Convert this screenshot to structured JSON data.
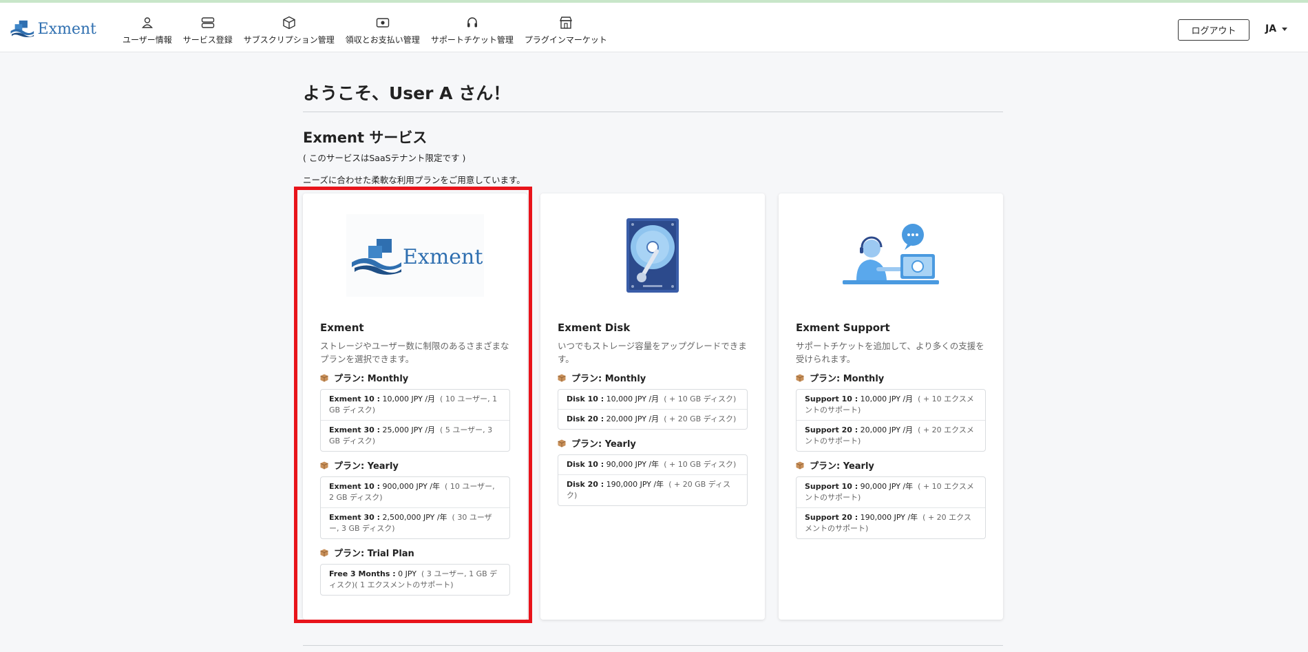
{
  "header": {
    "logo_text": "Exment",
    "nav": [
      {
        "label": "ユーザー情報",
        "icon": "user-icon"
      },
      {
        "label": "サービス登録",
        "icon": "server-icon"
      },
      {
        "label": "サブスクリプション管理",
        "icon": "box-icon"
      },
      {
        "label": "領収とお支払い管理",
        "icon": "money-icon"
      },
      {
        "label": "サポートチケット管理",
        "icon": "headset-icon"
      },
      {
        "label": "プラグインマーケット",
        "icon": "store-icon"
      }
    ],
    "logout_label": "ログアウト",
    "lang_label": "JA"
  },
  "main": {
    "welcome": "ようこそ、User A さん！",
    "services_title": "Exment サービス",
    "services_note": "( このサービスはSaaSテナント限定です )",
    "services_desc": "ニーズに合わせた柔軟な利用プランをご用意しています。"
  },
  "cards": [
    {
      "title": "Exment",
      "desc": "ストレージやユーザー数に制限のあるさまざまなプランを選択できます。",
      "logo_text": "Exment",
      "plans": [
        {
          "heading": "プラン: Monthly",
          "items": [
            {
              "name": "Exment 10 :",
              "price": "10,000 JPY /月",
              "detail": "( 10 ユーザー, 1 GB ディスク)"
            },
            {
              "name": "Exment 30 :",
              "price": "25,000 JPY /月",
              "detail": "( 5 ユーザー, 3 GB ディスク)"
            }
          ]
        },
        {
          "heading": "プラン: Yearly",
          "items": [
            {
              "name": "Exment 10 :",
              "price": "900,000 JPY /年",
              "detail": "( 10 ユーザー, 2 GB ディスク)"
            },
            {
              "name": "Exment 30 :",
              "price": "2,500,000 JPY /年",
              "detail": "( 30 ユーザー, 3 GB ディスク)"
            }
          ]
        },
        {
          "heading": "プラン: Trial Plan",
          "items": [
            {
              "name": "Free 3 Months :",
              "price": "0 JPY",
              "detail": "( 3 ユーザー, 1 GB ディスク)( 1 エクスメントのサポート)"
            }
          ]
        }
      ]
    },
    {
      "title": "Exment Disk",
      "desc": "いつでもストレージ容量をアップグレードできます。",
      "plans": [
        {
          "heading": "プラン: Monthly",
          "items": [
            {
              "name": "Disk 10 :",
              "price": "10,000 JPY /月",
              "detail": "( + 10 GB ディスク)"
            },
            {
              "name": "Disk 20 :",
              "price": "20,000 JPY /月",
              "detail": "( + 20 GB ディスク)"
            }
          ]
        },
        {
          "heading": "プラン: Yearly",
          "items": [
            {
              "name": "Disk 10 :",
              "price": "90,000 JPY /年",
              "detail": "( + 10 GB ディスク)"
            },
            {
              "name": "Disk 20 :",
              "price": "190,000 JPY /年",
              "detail": "( + 20 GB ディスク)"
            }
          ]
        }
      ]
    },
    {
      "title": "Exment Support",
      "desc": "サポートチケットを追加して、より多くの支援を受けられます。",
      "plans": [
        {
          "heading": "プラン: Monthly",
          "items": [
            {
              "name": "Support 10 :",
              "price": "10,000 JPY /月",
              "detail": "( + 10 エクスメントのサポート)"
            },
            {
              "name": "Support 20 :",
              "price": "20,000 JPY /月",
              "detail": "( + 20 エクスメントのサポート)"
            }
          ]
        },
        {
          "heading": "プラン: Yearly",
          "items": [
            {
              "name": "Support 10 :",
              "price": "90,000 JPY /年",
              "detail": "( + 10 エクスメントのサポート)"
            },
            {
              "name": "Support 20 :",
              "price": "190,000 JPY /年",
              "detail": "( + 20 エクスメントのサポート)"
            }
          ]
        }
      ]
    }
  ],
  "colors": {
    "highlight": "#e8141b",
    "brand": "#2f6fb0"
  }
}
